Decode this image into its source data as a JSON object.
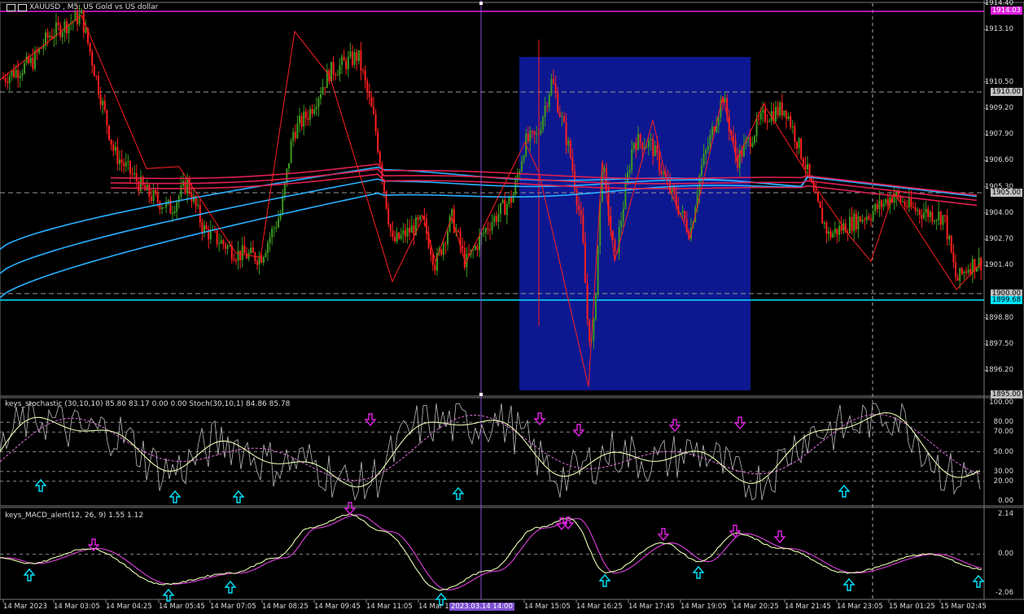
{
  "window": {
    "symbol_title": "XAUUSD , M5:  US Gold vs US dollar"
  },
  "price_axis": {
    "ticks": [
      "1914.40",
      "1913.10",
      "1910.50",
      "1909.20",
      "1907.90",
      "1906.60",
      "1905.30",
      "1904.00",
      "1902.70",
      "1901.40",
      "1898.80",
      "1897.50",
      "1896.20"
    ],
    "badges": [
      {
        "text": "1914.03",
        "bg": "#e020e0",
        "fg": "#ffffff"
      },
      {
        "text": "1910.00",
        "bg": "#c0c0c0",
        "fg": "#000000"
      },
      {
        "text": "1905.00",
        "bg": "#c0c0c0",
        "fg": "#000000"
      },
      {
        "text": "1900.00",
        "bg": "#c0c0c0",
        "fg": "#000000"
      },
      {
        "text": "1899.68",
        "bg": "#00e5ff",
        "fg": "#000000"
      },
      {
        "text": "1895.00",
        "bg": "#c0c0c0",
        "fg": "#000000"
      }
    ]
  },
  "stochastic": {
    "title": "keys_stochastic (30,10,10) 85.80 83.17 0.00 0.00 Stoch(30,10,1) 84.86 85.78",
    "ticks": [
      "100.00",
      "80.00",
      "70.00",
      "50.00",
      "30.00",
      "20.00",
      "0.00"
    ]
  },
  "macd": {
    "title": "keys_MACD_alert(12, 26, 9) 1.55 1.12",
    "ticks": [
      "2.14",
      "0.00",
      "-2.06"
    ]
  },
  "time_axis": {
    "labels": [
      "14 Mar 2023",
      "14 Mar 03:05",
      "14 Mar 04:25",
      "14 Mar 05:45",
      "14 Mar 07:05",
      "14 Mar 08:25",
      "14 Mar 09:45",
      "14 Mar 11:05",
      "14 Mar 1",
      "14 Mar 15:05",
      "14 Mar 16:25",
      "14 Mar 17:45",
      "14 Mar 19:05",
      "14 Mar 20:25",
      "14 Mar 21:45",
      "14 Mar 23:05",
      "15 Mar 01:25",
      "15 Mar 02:45"
    ],
    "cursor_time": "2023.03.14 14:00"
  },
  "colors": {
    "bull": "#3c9a1f",
    "bear": "#ff1e1e",
    "zigzag": "#ff1e1e",
    "ma_blue": "#2ab0ff",
    "ma_red": "#e02050",
    "box": "#0d1890",
    "cursor": "#8a4fd8",
    "arrow_up": "#00e5ff",
    "arrow_down": "#e020e0"
  }
}
